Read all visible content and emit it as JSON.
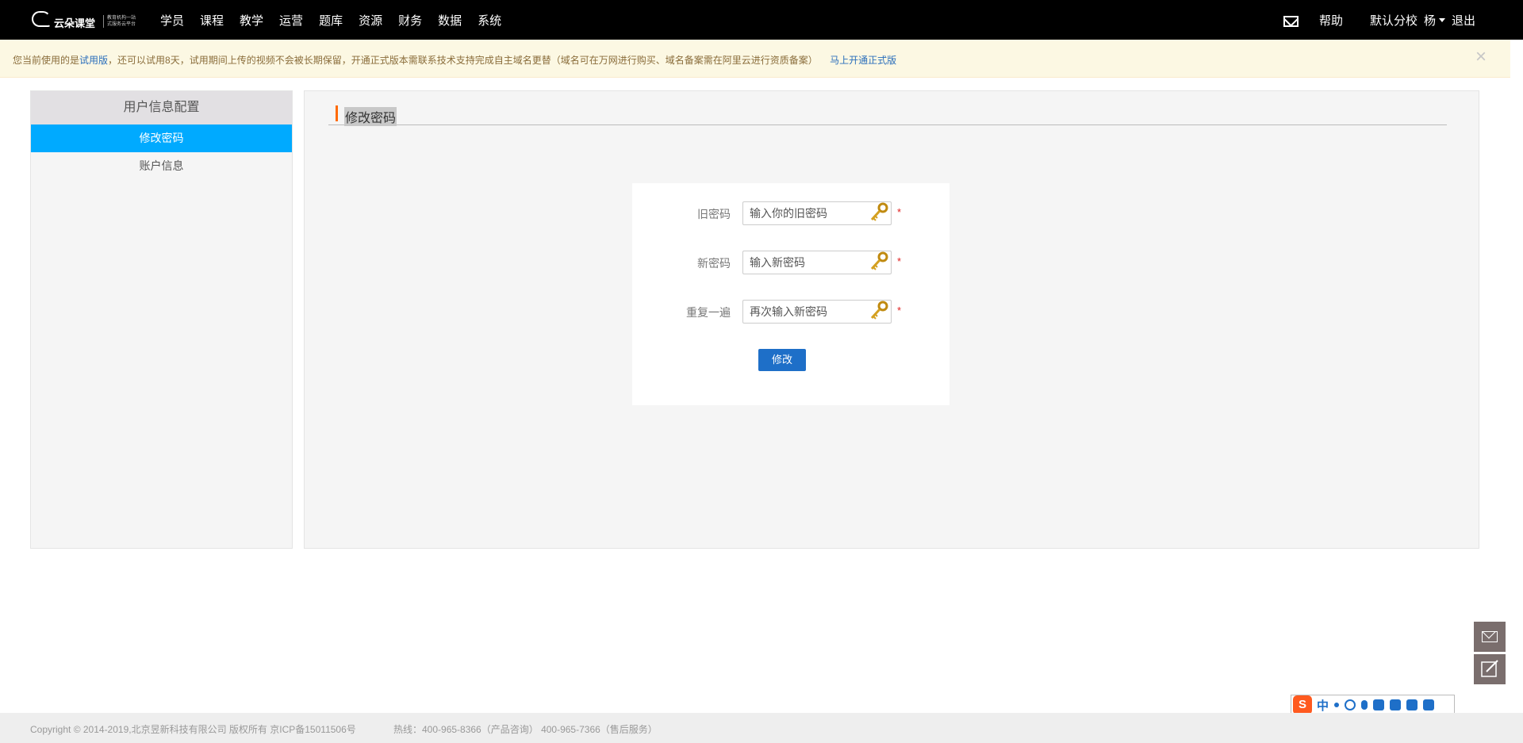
{
  "brand": {
    "name": "云朵课堂",
    "tagline_1": "教育机构一站",
    "tagline_2": "式服务云平台"
  },
  "nav": {
    "items": [
      "学员",
      "课程",
      "教学",
      "运营",
      "题库",
      "资源",
      "财务",
      "数据",
      "系统"
    ]
  },
  "header_right": {
    "help": "帮助",
    "campus": "默认分校",
    "user": "杨",
    "logout": "退出"
  },
  "notice": {
    "prefix": "您当前使用的是",
    "trial_link": "试用版",
    "body": "，还可以试用8天，试用期间上传的视频不会被长期保留，开通正式版本需联系技术支持完成自主域名更替（域名可在万网进行购买、域名备案需在阿里云进行资质备案）",
    "open_link": "马上开通正式版",
    "close": "×"
  },
  "sidebar": {
    "title": "用户信息配置",
    "items": [
      {
        "label": "修改密码",
        "active": true
      },
      {
        "label": "账户信息",
        "active": false
      }
    ]
  },
  "main": {
    "title": "修改密码",
    "fields": [
      {
        "label": "旧密码",
        "placeholder": "输入你的旧密码",
        "value": "",
        "required": "*"
      },
      {
        "label": "新密码",
        "placeholder": "输入新密码",
        "value": "",
        "required": "*"
      },
      {
        "label": "重复一遍",
        "placeholder": "再次输入新密码",
        "value": "",
        "required": "*"
      }
    ],
    "submit": "修改"
  },
  "ime": {
    "logo": "S",
    "lang": "中"
  },
  "footer": {
    "copyright": "Copyright © 2014-2019,北京昱新科技有限公司 版权所有 京ICP备15011506号",
    "hotline": "热线：400-965-8366（产品咨询） 400-965-7366（售后服务）"
  },
  "colors": {
    "topbar": "#000000",
    "accent": "#00aaff",
    "button": "#1e6fc8",
    "title_bar": "#ff6a00",
    "notice_bg": "#fcf8e3"
  }
}
